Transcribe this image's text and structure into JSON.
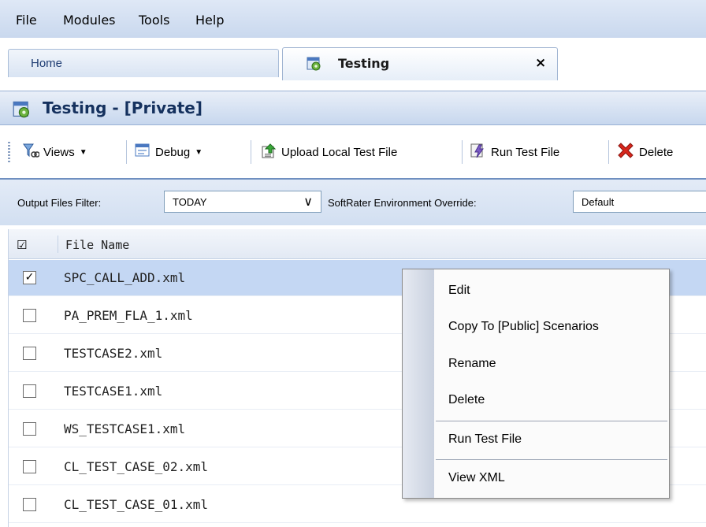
{
  "menubar": {
    "items": [
      "File",
      "Modules",
      "Tools",
      "Help"
    ]
  },
  "tabs": {
    "home": "Home",
    "testing": "Testing",
    "close": "×"
  },
  "panel": {
    "title": "Testing - [Private]"
  },
  "toolbar": {
    "views": "Views",
    "debug": "Debug",
    "upload": "Upload Local Test File",
    "run": "Run Test File",
    "delete": "Delete"
  },
  "filters": {
    "output_label": "Output Files Filter:",
    "output_value": "TODAY",
    "env_label": "SoftRater Environment Override:",
    "env_value": "Default"
  },
  "grid": {
    "header": "File Name",
    "rows": [
      {
        "name": "SPC_CALL_ADD.xml",
        "checked": true
      },
      {
        "name": "PA_PREM_FLA_1.xml",
        "checked": false
      },
      {
        "name": "TESTCASE2.xml",
        "checked": false
      },
      {
        "name": "TESTCASE1.xml",
        "checked": false
      },
      {
        "name": "WS_TESTCASE1.xml",
        "checked": false
      },
      {
        "name": "CL_TEST_CASE_02.xml",
        "checked": false
      },
      {
        "name": "CL_TEST_CASE_01.xml",
        "checked": false
      }
    ]
  },
  "context_menu": {
    "items": [
      "Edit",
      "Copy To [Public] Scenarios",
      "Rename",
      "Delete",
      "Run Test File",
      "View XML"
    ]
  },
  "colors": {
    "accent": "#15315e",
    "selection": "#c4d7f3",
    "delete_red": "#d8261c"
  }
}
